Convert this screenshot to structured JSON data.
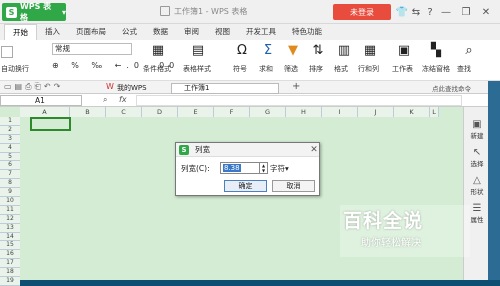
{
  "titlebar": {
    "app_label": "WPS 表格",
    "doc_title": "工作簿1 - WPS 表格",
    "login": "未登录"
  },
  "tabs": [
    "开始",
    "插入",
    "页面布局",
    "公式",
    "数据",
    "审阅",
    "视图",
    "开发工具",
    "特色功能"
  ],
  "ribbon": {
    "wrap": "自动换行",
    "number_format": "常规",
    "cond_format": "条件格式",
    "table_style": "表格样式",
    "symbol": "符号",
    "sum": "求和",
    "filter": "筛选",
    "sort": "排序",
    "format": "格式",
    "rowcol": "行和列",
    "sheet": "工作表",
    "freeze": "冻结窗格",
    "find": "查找"
  },
  "quickbar": {
    "mywps": "我的WPS",
    "doc_tab": "工作簿1",
    "search": "点此查找命令"
  },
  "formula": {
    "cell": "A1",
    "fx": "fx"
  },
  "columns": [
    "A",
    "B",
    "C",
    "D",
    "E",
    "F",
    "G",
    "H",
    "I",
    "J",
    "K",
    "L"
  ],
  "rows": [
    "1",
    "2",
    "3",
    "4",
    "5",
    "6",
    "7",
    "8",
    "9",
    "10",
    "11",
    "12",
    "13",
    "14",
    "15",
    "16",
    "17",
    "18",
    "19"
  ],
  "side": {
    "new": "新建",
    "select": "选择",
    "shape": "形状",
    "attr": "属性"
  },
  "dialog": {
    "title": "列宽",
    "label": "列宽(C):",
    "value": "8.38",
    "unit": "字符",
    "ok": "确定",
    "cancel": "取消"
  },
  "watermark": {
    "line1": "百科全说",
    "line2": "助你轻松解决"
  }
}
